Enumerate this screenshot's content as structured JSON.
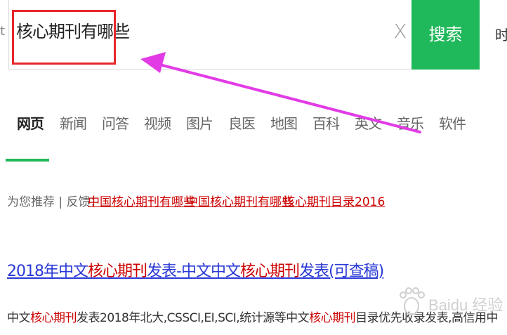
{
  "search": {
    "query": "核心期刊有哪些",
    "clear_label": "X",
    "button_label": "搜索",
    "edge_char": "时"
  },
  "tabs": [
    {
      "label": "网页",
      "active": true
    },
    {
      "label": "新闻"
    },
    {
      "label": "问答"
    },
    {
      "label": "视频"
    },
    {
      "label": "图片"
    },
    {
      "label": "良医"
    },
    {
      "label": "地图"
    },
    {
      "label": "百科"
    },
    {
      "label": "英文"
    },
    {
      "label": "音乐"
    },
    {
      "label": "软件"
    }
  ],
  "recommend": {
    "prefix": "为您推荐 | 反馈：",
    "links": [
      "中国核心期刊有哪些",
      "中国核心期刊有哪些",
      "核心期刊目录2016"
    ]
  },
  "result": {
    "title_parts": [
      {
        "text": "2018年中文",
        "hl": false
      },
      {
        "text": "核心期刊",
        "hl": true
      },
      {
        "text": "发表-中文中文",
        "hl": false
      },
      {
        "text": "核心期刊",
        "hl": true
      },
      {
        "text": "发表(可查稿)",
        "hl": false
      }
    ],
    "snippet_parts": [
      {
        "text": "中文",
        "hl": false
      },
      {
        "text": "核心期刊",
        "hl": true
      },
      {
        "text": "发表2018年北大,CSSCI,EI,SCI,统计源等中文",
        "hl": false
      },
      {
        "text": "核心期刊",
        "hl": true
      },
      {
        "text": "目录优先收录发表,高信用中",
        "hl": false
      }
    ]
  },
  "watermark": {
    "text": "Baidu 经验"
  },
  "colors": {
    "accent_green": "#1fb85a",
    "highlight_red": "#e8262c",
    "arrow_magenta": "#e23be6",
    "link_blue": "#2a39d6",
    "keyword_red": "#cc0000"
  }
}
